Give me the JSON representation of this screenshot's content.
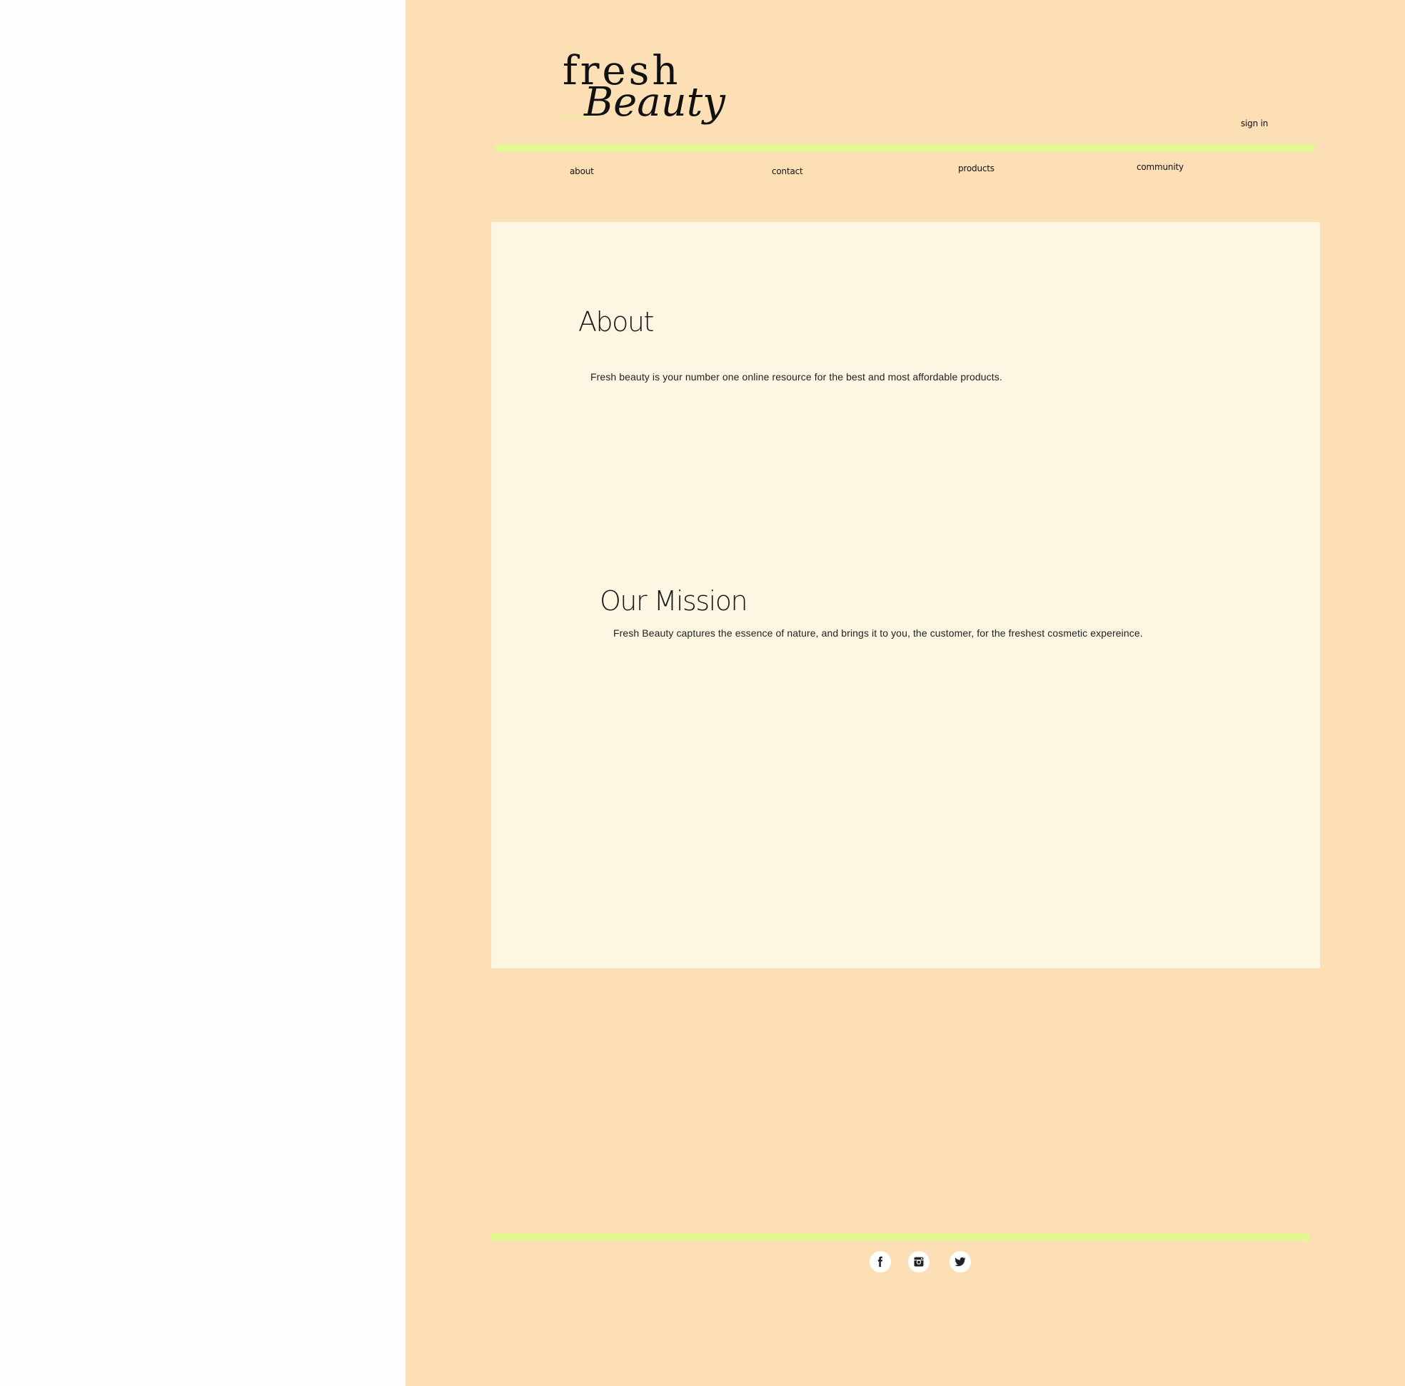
{
  "brand": {
    "logo_line1": "fresh",
    "logo_line2": "Beauty"
  },
  "header": {
    "signin_label": "sign in"
  },
  "nav": {
    "items": [
      {
        "label": "about"
      },
      {
        "label": "contact"
      },
      {
        "label": "products"
      },
      {
        "label": "community"
      }
    ]
  },
  "main": {
    "about_heading": "About",
    "about_text": "Fresh beauty is your number one online resource for the best and most affordable products.",
    "mission_heading": "Our Mission",
    "mission_text": "Fresh Beauty captures the essence of nature, and brings it to you, the customer, for the freshest cosmetic expereince."
  },
  "footer": {
    "social_icons": [
      "facebook-icon",
      "instagram-icon",
      "twitter-icon"
    ]
  },
  "colors": {
    "page_background": "#fddfb6",
    "content_background": "#fdf6e3",
    "accent_bar": "#e1f990",
    "left_background": "#fefefe"
  }
}
